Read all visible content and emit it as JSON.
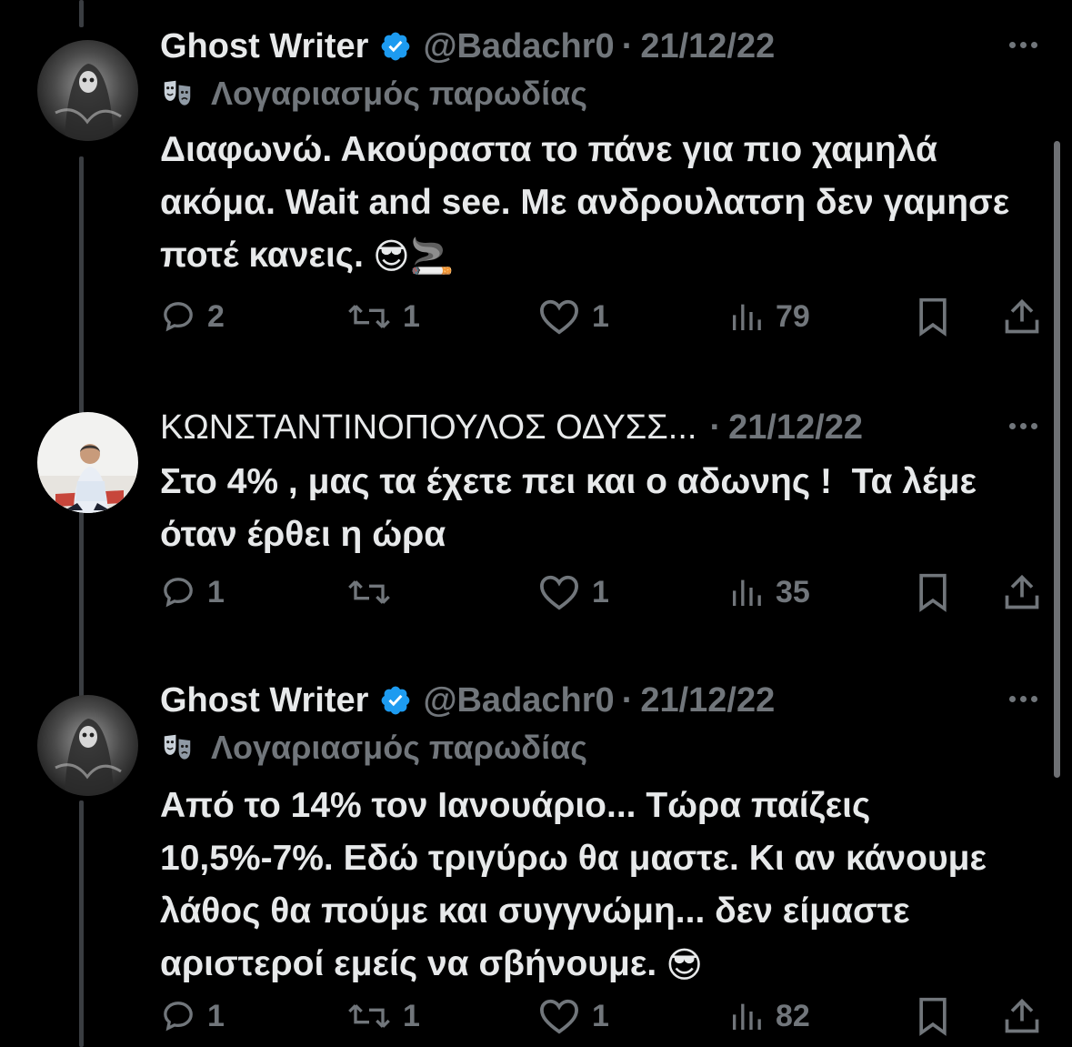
{
  "icons": {
    "reply": "speech-bubble-icon",
    "retweet": "retweet-icon",
    "like": "heart-icon",
    "views": "bar-chart-icon",
    "bookmark": "bookmark-icon",
    "share": "share-icon",
    "more": "more-dots-icon",
    "verified": "verified-badge-icon",
    "parody": "theater-mask-icon"
  },
  "colors": {
    "background": "#000000",
    "text": "#e7e9ea",
    "muted": "#71767b",
    "verified": "#1d9bf0"
  },
  "tweets": [
    {
      "name": "Ghost Writer",
      "verified": true,
      "handle": "@Badachr0",
      "separator": "·",
      "date": "21/12/22",
      "label": "Λογαριασμός παρωδίας",
      "text": "Διαφωνώ. Ακούραστα το πάνε για πιο χαμηλά ακόμα. Wait and see. Με ανδρουλατση δεν γαμησε ποτέ κανεις.",
      "emojis": "😎🚬",
      "replies": "2",
      "retweets": "1",
      "likes": "1",
      "views": "79"
    },
    {
      "name": "ΚΩΝΣΤΑΝΤΙΝΟΠΟΥΛΟΣ ΟΔΥΣΣ...",
      "verified": false,
      "separator": "·",
      "date": "21/12/22",
      "text": "Στο 4% , μας τα έχετε πει και ο αδωνης !  Τα λέμε όταν έρθει η ώρα",
      "replies": "1",
      "retweets": "",
      "likes": "1",
      "views": "35"
    },
    {
      "name": "Ghost Writer",
      "verified": true,
      "handle": "@Badachr0",
      "separator": "·",
      "date": "21/12/22",
      "label": "Λογαριασμός παρωδίας",
      "text": "Από το 14% τον Ιανουάριο... Τώρα παίζεις 10,5%-7%. Εδώ τριγύρω θα μαστε. Κι αν κάνουμε λάθος θα πούμε και συγγνώμη... δεν είμαστε αριστεροί εμείς να σβήνουμε.",
      "emojis": "😎",
      "replies": "1",
      "retweets": "1",
      "likes": "1",
      "views": "82"
    }
  ]
}
